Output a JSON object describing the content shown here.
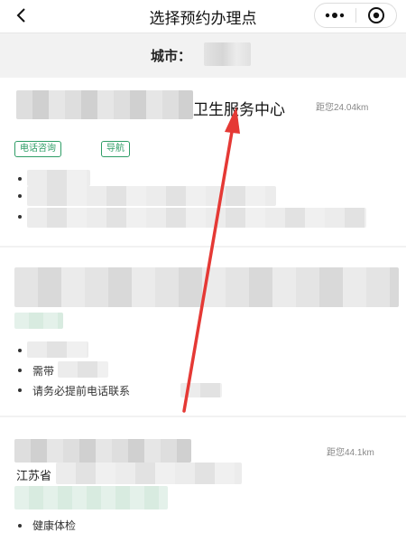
{
  "header": {
    "title": "选择预约办理点",
    "back_icon": "back-chevron-icon",
    "more_icon": "more-dots-icon",
    "target_icon": "target-circle-icon"
  },
  "city": {
    "label": "城市："
  },
  "card1": {
    "name_visible": "卫生服务中心",
    "distance": "距您24.04km",
    "tags": [
      "电话咨询",
      "导航"
    ]
  },
  "card2": {
    "notes": [
      "需带",
      "请务必提前电话联系"
    ]
  },
  "card3": {
    "distance": "距您44.1km",
    "address_start": "江苏省",
    "services": [
      "健康体检"
    ]
  },
  "annotation": {
    "color": "#e53935"
  }
}
